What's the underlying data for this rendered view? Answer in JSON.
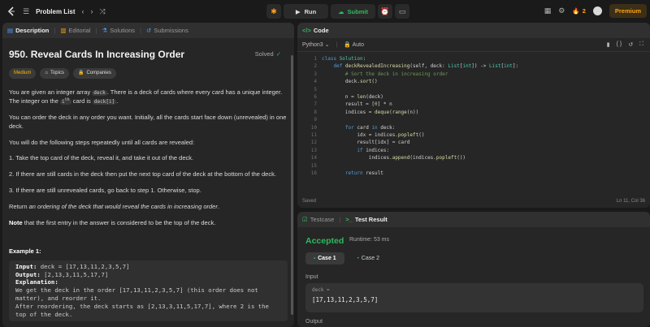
{
  "topbar": {
    "problem_list": "Problem List",
    "run": "Run",
    "submit": "Submit",
    "streak": "2",
    "premium": "Premium"
  },
  "left_tabs": [
    "Description",
    "Editorial",
    "Solutions",
    "Submissions"
  ],
  "problem": {
    "title": "950. Reveal Cards In Increasing Order",
    "solved": "Solved",
    "difficulty": "Medium",
    "topics": "Topics",
    "companies": "Companies",
    "p1a": "You are given an integer array ",
    "p1_code1": "deck",
    "p1b": ". There is a deck of cards where every card has a unique integer. The integer on the ",
    "p1_i": "i",
    "p1_th": "th",
    "p1c": " card is ",
    "p1_code2": "deck[i]",
    "p1d": ".",
    "p2": "You can order the deck in any order you want. Initially, all the cards start face down (unrevealed) in one deck.",
    "p3": "You will do the following steps repeatedly until all cards are revealed:",
    "s1": "1. Take the top card of the deck, reveal it, and take it out of the deck.",
    "s2": "2. If there are still cards in the deck then put the next top card of the deck at the bottom of the deck.",
    "s3": "3. If there are still unrevealed cards, go back to step 1. Otherwise, stop.",
    "p4a": "Return ",
    "p4b": "an ordering of the deck that would reveal the cards in increasing order",
    "p4c": ".",
    "note_b": "Note",
    "note": " that the first entry in the answer is considered to be the top of the deck.",
    "example_title": "Example 1:",
    "ex_input_label": "Input:",
    "ex_input": " deck = [17,13,11,2,3,5,7]",
    "ex_output_label": "Output:",
    "ex_output": " [2,13,3,11,5,17,7]",
    "ex_expl_label": "Explanation:",
    "ex_l1": "We get the deck in the order [17,13,11,2,3,5,7] (this order does not",
    "ex_l2": "matter), and reorder it.",
    "ex_l3": "After reordering, the deck starts as [2,13,3,11,5,17,7], where 2 is the",
    "ex_l4": "top of the deck."
  },
  "code_panel": {
    "tab": "Code",
    "language": "Python3",
    "auto": "Auto",
    "saved": "Saved",
    "cursor": "Ln 11, Col 36",
    "lines": [
      {
        "n": "1",
        "t": "class Solution:"
      },
      {
        "n": "2",
        "t": "    def deckRevealedIncreasing(self, deck: List[int]) -> List[int]:"
      },
      {
        "n": "3",
        "t": "        # Sort the deck in increasing order"
      },
      {
        "n": "4",
        "t": "        deck.sort()"
      },
      {
        "n": "5",
        "t": ""
      },
      {
        "n": "6",
        "t": "        n = len(deck)"
      },
      {
        "n": "7",
        "t": "        result = [0] * n"
      },
      {
        "n": "8",
        "t": "        indices = deque(range(n))"
      },
      {
        "n": "9",
        "t": ""
      },
      {
        "n": "10",
        "t": "        for card in deck:"
      },
      {
        "n": "11",
        "t": "            idx = indices.popleft()"
      },
      {
        "n": "12",
        "t": "            result[idx] = card"
      },
      {
        "n": "13",
        "t": "            if indices:"
      },
      {
        "n": "14",
        "t": "                indices.append(indices.popleft())"
      },
      {
        "n": "15",
        "t": ""
      },
      {
        "n": "16",
        "t": "        return result"
      }
    ]
  },
  "result_panel": {
    "tab1": "Testcase",
    "tab2": "Test Result",
    "status": "Accepted",
    "runtime": "Runtime: 53 ms",
    "case1": "Case 1",
    "case2": "Case 2",
    "input_label": "Input",
    "input_key": "deck =",
    "input_value": "[17,13,11,2,3,5,7]",
    "output_label": "Output"
  },
  "colors": {
    "accent": "#ffa116",
    "success": "#2cbb5d",
    "bg": "#1a1a1a",
    "panel": "#262626"
  }
}
